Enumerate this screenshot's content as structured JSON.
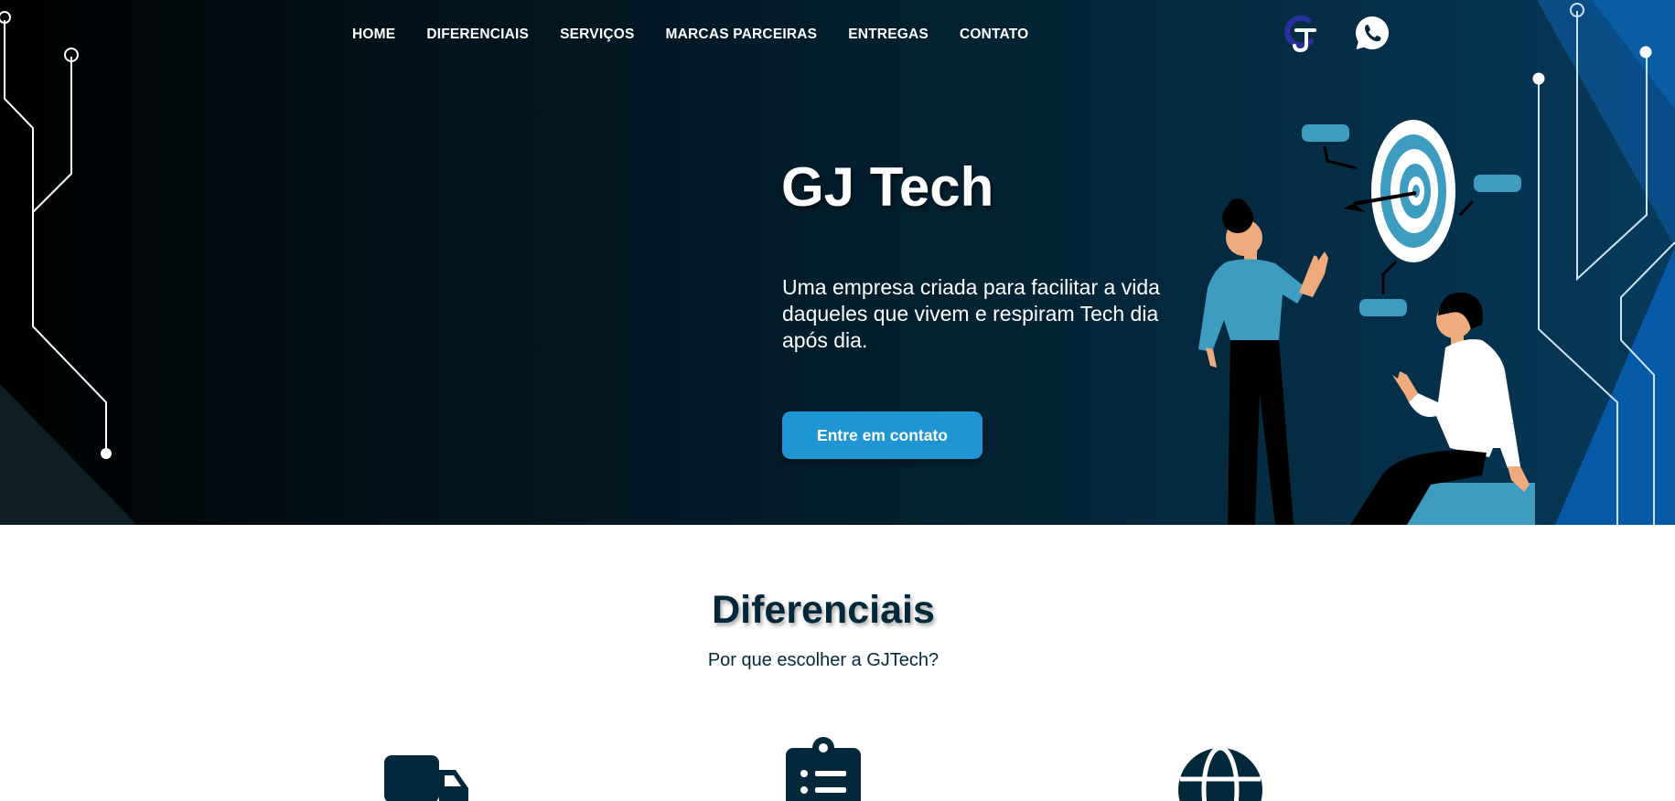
{
  "nav": {
    "items": [
      {
        "label": "HOME"
      },
      {
        "label": "DIFERENCIAIS"
      },
      {
        "label": "SERVIÇOS"
      },
      {
        "label": "MARCAS PARCEIRAS"
      },
      {
        "label": "ENTREGAS"
      },
      {
        "label": "CONTATO"
      }
    ],
    "icons": [
      "gj-logo-icon",
      "whatsapp-icon"
    ]
  },
  "hero": {
    "title": "GJ Tech",
    "text": "Uma empresa criada para facilitar a vida daqueles que vivem e respiram Tech dia após dia.",
    "cta_label": "Entre em contato"
  },
  "diferenciais": {
    "title": "Diferenciais",
    "subtitle": "Por que escolher a GJTech?",
    "icons": [
      "truck-icon",
      "clipboard-list-icon",
      "globe-icon"
    ]
  },
  "colors": {
    "primary_dark": "#04283b",
    "accent": "#1f96d3",
    "illustration_blue": "#3f9cc1"
  }
}
